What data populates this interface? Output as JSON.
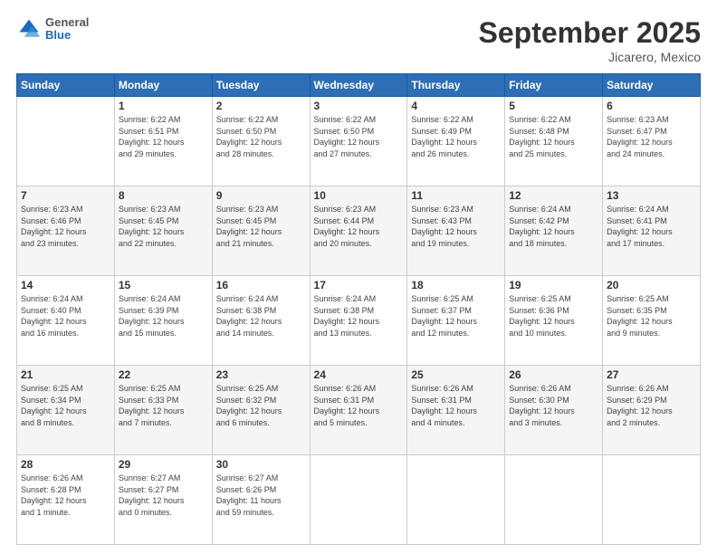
{
  "header": {
    "logo": {
      "general": "General",
      "blue": "Blue"
    },
    "title": "September 2025",
    "subtitle": "Jicarero, Mexico"
  },
  "days_of_week": [
    "Sunday",
    "Monday",
    "Tuesday",
    "Wednesday",
    "Thursday",
    "Friday",
    "Saturday"
  ],
  "weeks": [
    [
      {
        "day": "",
        "info": ""
      },
      {
        "day": "1",
        "info": "Sunrise: 6:22 AM\nSunset: 6:51 PM\nDaylight: 12 hours\nand 29 minutes."
      },
      {
        "day": "2",
        "info": "Sunrise: 6:22 AM\nSunset: 6:50 PM\nDaylight: 12 hours\nand 28 minutes."
      },
      {
        "day": "3",
        "info": "Sunrise: 6:22 AM\nSunset: 6:50 PM\nDaylight: 12 hours\nand 27 minutes."
      },
      {
        "day": "4",
        "info": "Sunrise: 6:22 AM\nSunset: 6:49 PM\nDaylight: 12 hours\nand 26 minutes."
      },
      {
        "day": "5",
        "info": "Sunrise: 6:22 AM\nSunset: 6:48 PM\nDaylight: 12 hours\nand 25 minutes."
      },
      {
        "day": "6",
        "info": "Sunrise: 6:23 AM\nSunset: 6:47 PM\nDaylight: 12 hours\nand 24 minutes."
      }
    ],
    [
      {
        "day": "7",
        "info": "Sunrise: 6:23 AM\nSunset: 6:46 PM\nDaylight: 12 hours\nand 23 minutes."
      },
      {
        "day": "8",
        "info": "Sunrise: 6:23 AM\nSunset: 6:45 PM\nDaylight: 12 hours\nand 22 minutes."
      },
      {
        "day": "9",
        "info": "Sunrise: 6:23 AM\nSunset: 6:45 PM\nDaylight: 12 hours\nand 21 minutes."
      },
      {
        "day": "10",
        "info": "Sunrise: 6:23 AM\nSunset: 6:44 PM\nDaylight: 12 hours\nand 20 minutes."
      },
      {
        "day": "11",
        "info": "Sunrise: 6:23 AM\nSunset: 6:43 PM\nDaylight: 12 hours\nand 19 minutes."
      },
      {
        "day": "12",
        "info": "Sunrise: 6:24 AM\nSunset: 6:42 PM\nDaylight: 12 hours\nand 18 minutes."
      },
      {
        "day": "13",
        "info": "Sunrise: 6:24 AM\nSunset: 6:41 PM\nDaylight: 12 hours\nand 17 minutes."
      }
    ],
    [
      {
        "day": "14",
        "info": "Sunrise: 6:24 AM\nSunset: 6:40 PM\nDaylight: 12 hours\nand 16 minutes."
      },
      {
        "day": "15",
        "info": "Sunrise: 6:24 AM\nSunset: 6:39 PM\nDaylight: 12 hours\nand 15 minutes."
      },
      {
        "day": "16",
        "info": "Sunrise: 6:24 AM\nSunset: 6:38 PM\nDaylight: 12 hours\nand 14 minutes."
      },
      {
        "day": "17",
        "info": "Sunrise: 6:24 AM\nSunset: 6:38 PM\nDaylight: 12 hours\nand 13 minutes."
      },
      {
        "day": "18",
        "info": "Sunrise: 6:25 AM\nSunset: 6:37 PM\nDaylight: 12 hours\nand 12 minutes."
      },
      {
        "day": "19",
        "info": "Sunrise: 6:25 AM\nSunset: 6:36 PM\nDaylight: 12 hours\nand 10 minutes."
      },
      {
        "day": "20",
        "info": "Sunrise: 6:25 AM\nSunset: 6:35 PM\nDaylight: 12 hours\nand 9 minutes."
      }
    ],
    [
      {
        "day": "21",
        "info": "Sunrise: 6:25 AM\nSunset: 6:34 PM\nDaylight: 12 hours\nand 8 minutes."
      },
      {
        "day": "22",
        "info": "Sunrise: 6:25 AM\nSunset: 6:33 PM\nDaylight: 12 hours\nand 7 minutes."
      },
      {
        "day": "23",
        "info": "Sunrise: 6:25 AM\nSunset: 6:32 PM\nDaylight: 12 hours\nand 6 minutes."
      },
      {
        "day": "24",
        "info": "Sunrise: 6:26 AM\nSunset: 6:31 PM\nDaylight: 12 hours\nand 5 minutes."
      },
      {
        "day": "25",
        "info": "Sunrise: 6:26 AM\nSunset: 6:31 PM\nDaylight: 12 hours\nand 4 minutes."
      },
      {
        "day": "26",
        "info": "Sunrise: 6:26 AM\nSunset: 6:30 PM\nDaylight: 12 hours\nand 3 minutes."
      },
      {
        "day": "27",
        "info": "Sunrise: 6:26 AM\nSunset: 6:29 PM\nDaylight: 12 hours\nand 2 minutes."
      }
    ],
    [
      {
        "day": "28",
        "info": "Sunrise: 6:26 AM\nSunset: 6:28 PM\nDaylight: 12 hours\nand 1 minute."
      },
      {
        "day": "29",
        "info": "Sunrise: 6:27 AM\nSunset: 6:27 PM\nDaylight: 12 hours\nand 0 minutes."
      },
      {
        "day": "30",
        "info": "Sunrise: 6:27 AM\nSunset: 6:26 PM\nDaylight: 11 hours\nand 59 minutes."
      },
      {
        "day": "",
        "info": ""
      },
      {
        "day": "",
        "info": ""
      },
      {
        "day": "",
        "info": ""
      },
      {
        "day": "",
        "info": ""
      }
    ]
  ]
}
